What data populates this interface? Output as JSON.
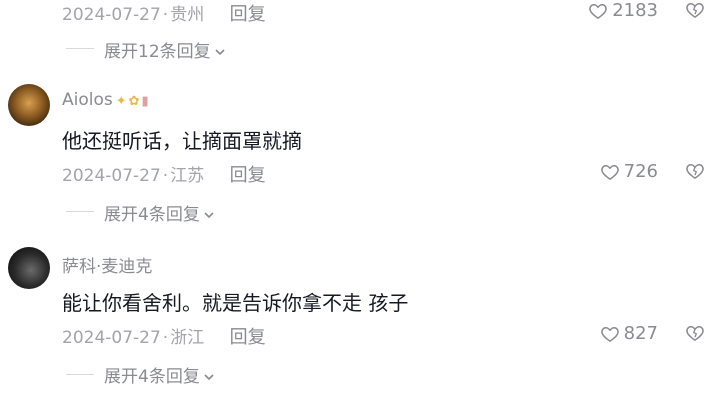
{
  "comments": [
    {
      "meta": {
        "date": "2024-07-27",
        "location": "贵州",
        "reply_label": "回复"
      },
      "likes": "2183",
      "expand_label": "展开12条回复"
    },
    {
      "username": "Aiolos",
      "text": "他还挺听话，让摘面罩就摘",
      "meta": {
        "date": "2024-07-27",
        "location": "江苏",
        "reply_label": "回复"
      },
      "likes": "726",
      "expand_label": "展开4条回复"
    },
    {
      "username": "萨科·麦迪克",
      "text": "能让你看舍利。就是告诉你拿不走 孩子",
      "meta": {
        "date": "2024-07-27",
        "location": "浙江",
        "reply_label": "回复"
      },
      "likes": "827",
      "expand_label": "展开4条回复"
    }
  ],
  "icons": {
    "like": "heart-icon",
    "dislike": "broken-heart-icon",
    "expand": "chevron-down-icon"
  }
}
